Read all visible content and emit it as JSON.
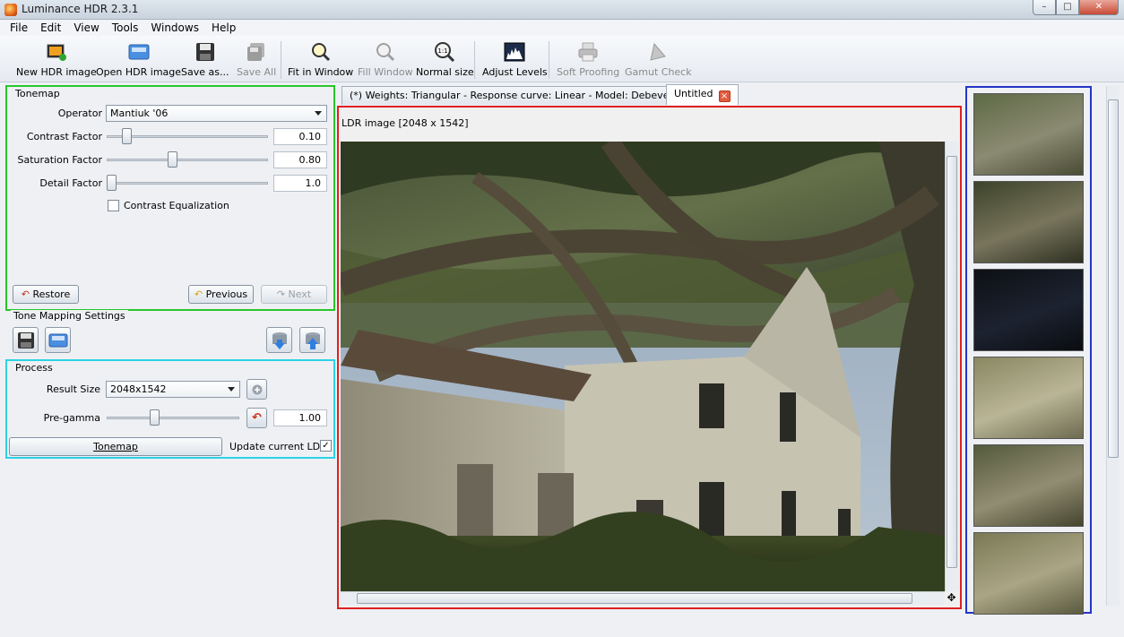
{
  "window": {
    "title": "Luminance HDR 2.3.1",
    "btn_min": "–",
    "btn_max": "□",
    "btn_close": "✕"
  },
  "menu": [
    "File",
    "Edit",
    "View",
    "Tools",
    "Windows",
    "Help"
  ],
  "toolbar": {
    "new_hdr": "New HDR image",
    "open_hdr": "Open HDR image",
    "save_as": "Save as...",
    "save_all": "Save All",
    "fit_window": "Fit in Window",
    "fill_window": "Fill Window",
    "normal_size": "Normal size",
    "normal_size_glyph": "1:1",
    "adjust_levels": "Adjust Levels",
    "soft_proofing": "Soft Proofing",
    "gamut_check": "Gamut Check"
  },
  "tonemap": {
    "title": "Tonemap",
    "operator_label": "Operator",
    "operator_value": "Mantiuk '06",
    "contrast_label": "Contrast Factor",
    "contrast_value": "0.10",
    "contrast_level": 0.1,
    "saturation_label": "Saturation Factor",
    "saturation_value": "0.80",
    "saturation_level": 0.4,
    "detail_label": "Detail Factor",
    "detail_value": "1.0",
    "detail_level": 0.0,
    "equalization_label": "Contrast Equalization",
    "restore": "Restore",
    "previous": "Previous",
    "next": "Next"
  },
  "settings": {
    "title": "Tone Mapping Settings"
  },
  "process": {
    "title": "Process",
    "result_size_label": "Result Size",
    "result_size_value": "2048x1542",
    "pregamma_label": "Pre-gamma",
    "pregamma_value": "1.00",
    "pregamma_level": 0.35,
    "tonemap_button": "Tonemap",
    "update_ldr_label": "Update current LDR",
    "update_ldr_checked": "✓"
  },
  "tabs": [
    {
      "label": "(*) Weights: Triangular - Response curve: Linear - Model: Debevec"
    },
    {
      "label": "Untitled"
    }
  ],
  "viewer": {
    "caption": "LDR image [2048 x 1542]"
  },
  "colors": {
    "tonemap_border": "#29c629",
    "process_border": "#2ad3e6",
    "viewer_border": "#e02020",
    "preview_border": "#2434c8"
  }
}
